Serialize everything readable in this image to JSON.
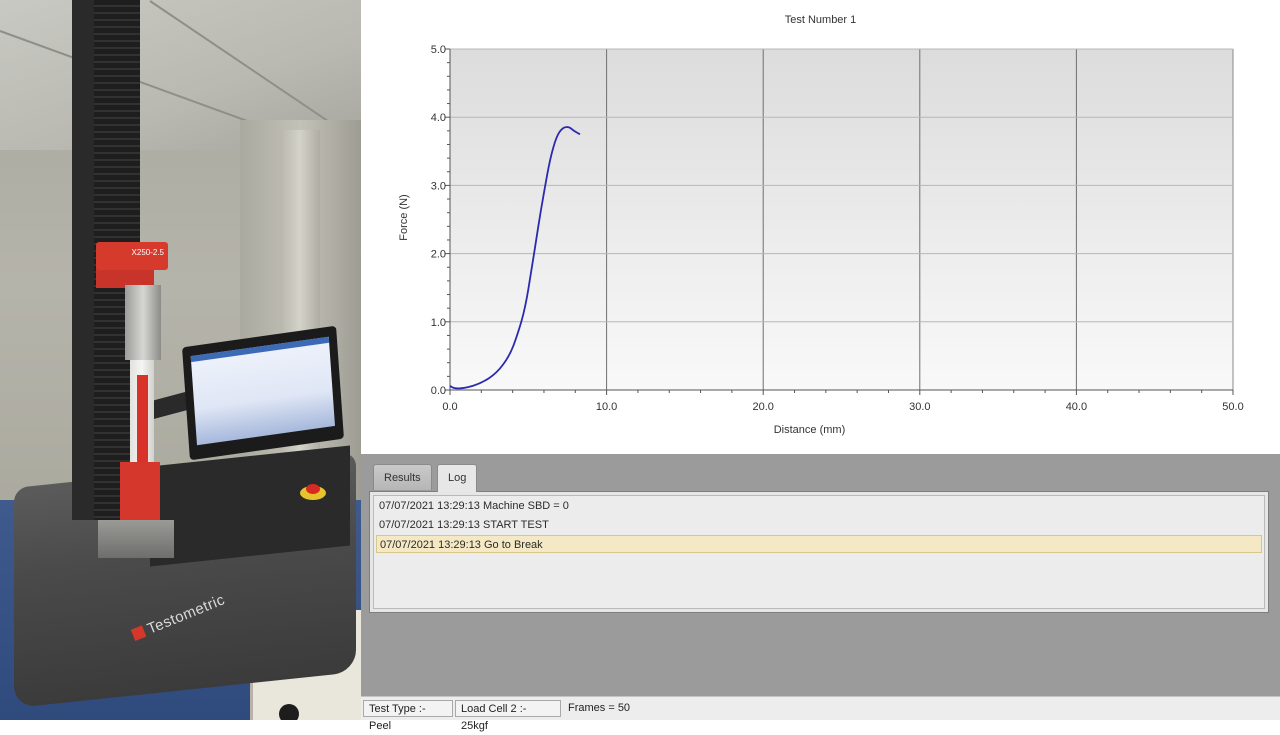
{
  "photo": {
    "loadcell_label": "X250-2.5",
    "brand": "Testometric"
  },
  "colors": {
    "curve": "#2a2ab0",
    "grid": "#b7b7b7",
    "axis": "#555555",
    "selected_row": "#f4e9c4"
  },
  "chart_data": {
    "type": "line",
    "title": "Test Number 1",
    "xlabel": "Distance (mm)",
    "ylabel": "Force (N)",
    "xlim": [
      0,
      50
    ],
    "ylim": [
      0,
      5
    ],
    "xticks": [
      "0.0",
      "10.0",
      "20.0",
      "30.0",
      "40.0",
      "50.0"
    ],
    "yticks": [
      "0.0",
      "1.0",
      "2.0",
      "3.0",
      "4.0",
      "5.0"
    ],
    "grid": true,
    "series": [
      {
        "x": [
          0.0,
          0.3,
          1.0,
          2.0,
          3.0,
          3.8,
          4.3,
          4.8,
          5.2,
          5.6,
          6.0,
          6.4,
          6.8,
          7.2,
          7.6,
          7.9,
          8.3
        ],
        "y": [
          0.06,
          0.02,
          0.03,
          0.1,
          0.25,
          0.5,
          0.8,
          1.2,
          1.75,
          2.35,
          2.9,
          3.4,
          3.72,
          3.85,
          3.86,
          3.8,
          3.75
        ]
      }
    ]
  },
  "tabs": [
    {
      "label": "Results",
      "active": false
    },
    {
      "label": "Log",
      "active": true
    }
  ],
  "log": [
    {
      "text": "07/07/2021 13:29:13 Machine SBD = 0",
      "selected": false
    },
    {
      "text": "07/07/2021 13:29:13 START TEST",
      "selected": false
    },
    {
      "text": "07/07/2021 13:29:13 Go to Break",
      "selected": true
    }
  ],
  "status_bar": {
    "test_type": "Test Type :- Peel",
    "load_cell": "Load Cell 2 :- 25kgf",
    "frames": "Frames = 50"
  }
}
